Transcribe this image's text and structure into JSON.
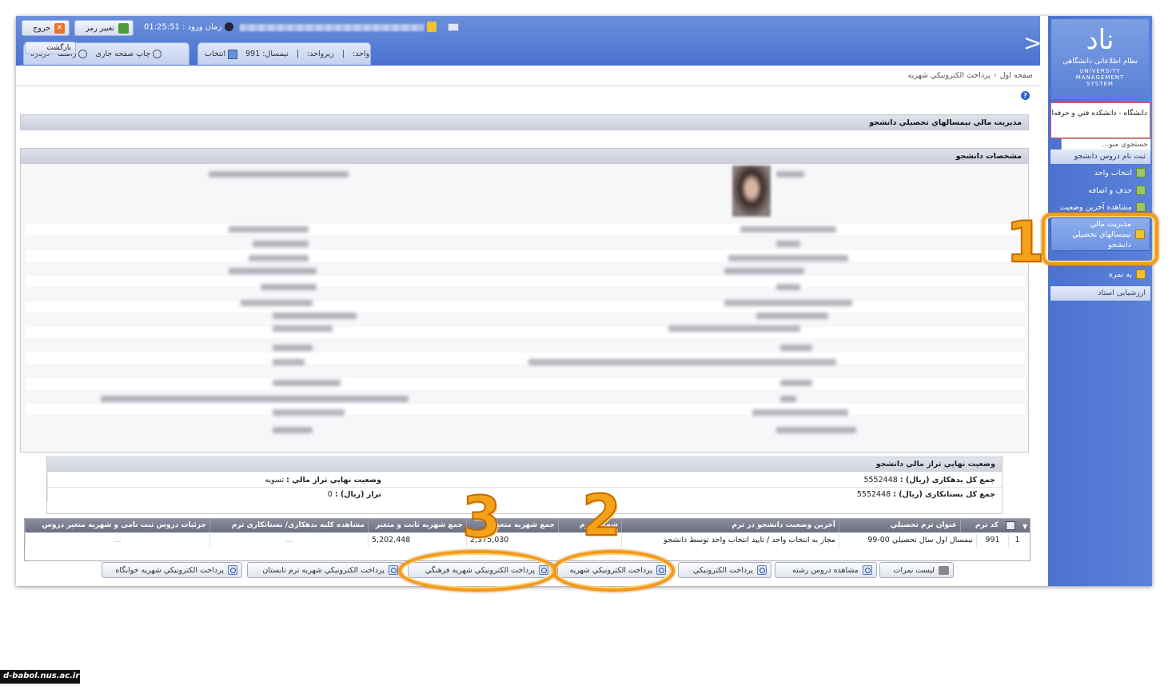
{
  "topbar": {
    "logout_label": "خروج",
    "change_password_label": "تغيير رمز",
    "login_time_label": "زمان ورود :",
    "login_time_value": "01:25:51",
    "tabs_right": {
      "unit_label": "واحد:",
      "term_label": "زيرواحد:",
      "semester_label": "نيمسال:",
      "semester_value": "991",
      "select_label": "انتخاب"
    },
    "tabs_left": {
      "print_label": "چاپ صفحه جاری",
      "guide_label": "راهنما",
      "about_label": "درباره",
      "back_label": "بازگشت"
    }
  },
  "sidebar": {
    "logo_mark": "ناد",
    "logo_fa": "نظام اطلاعاتی دانشگاهی",
    "logo_en": [
      "UNIVERSITY",
      "MANAGEMENT",
      "SYSTEM"
    ],
    "university": "دانشگاه - دانشكده فني و حرفه‌اي",
    "search_placeholder": "جستجوی منو...",
    "section_head": "ثبت نام دروس دانشجو",
    "items": [
      {
        "label": "انتخاب واحد"
      },
      {
        "label": "حذف و اضافه"
      },
      {
        "label": "مشاهده آخرين وضعيت"
      },
      {
        "label": "مديريت مالي نيمسالهاي تحصيلي دانشجو"
      },
      {
        "label": "به نمره"
      }
    ],
    "eval_head": "ارزشيابی استاد"
  },
  "breadcrumb": {
    "home": "صفحه اول",
    "current": "پرداخت الكترونيكي شهريه"
  },
  "page": {
    "title": "مديريت مالي نيمسالهاي تحصيلي دانشجو",
    "student_section": "مشخصات دانشجو"
  },
  "status": {
    "title": "وضعيت نهايي تراز مالي دانشجو",
    "total_debt_label": "جمع كل بدهكاری (ريال) :",
    "total_debt_value": "5552448",
    "total_credit_label": "جمع كل بستانكاری (ريال) :",
    "total_credit_value": "5552448",
    "final_status_label": "وضعيت نهايي تراز مالي :",
    "final_status_value": "تسويه",
    "balance_label": "تراز (ريال) :",
    "balance_value": "0"
  },
  "grid": {
    "headers": [
      "كد ترم",
      "عنوان ترم تحصيلي",
      "آخرين وضعيت دانشجو در ترم",
      "شهريه ترم",
      "جمع شهريه متغير",
      "جمع شهريه ثابت و متغير",
      "مشاهده كليه بدهكاری/ بستانكاری ترم",
      "جزئيات دروس ثبت نامی و شهريه متغير دروس"
    ],
    "row": {
      "index": "1",
      "term_code": "991",
      "term_title": "نيمسال اول سال تحصيلي 00-99",
      "status": "مجاز به انتخاب واحد / تاييد انتخاب واحد توسط دانشجو",
      "var_tuition": "2,375,030",
      "total_tuition": "5,202,448",
      "more1": "...",
      "more2": "..."
    }
  },
  "actions": [
    "ليست نمرات",
    "مشاهده دروس رشته",
    "پرداخت الكترونيكي",
    "پرداخت الكترونيكي شهريه",
    "پرداخت الكترونيكي شهريه فرهنگي",
    "پرداخت الكترونيكي شهريه ترم تابستان",
    "پرداخت الكترونيكي شهريه خوابگاه"
  ],
  "callouts": [
    "1",
    "2",
    "3"
  ],
  "watermark": "d-babol.nus.ac.ir",
  "colors": {
    "accent": "#4a72cf",
    "callout": "#f39a19"
  }
}
